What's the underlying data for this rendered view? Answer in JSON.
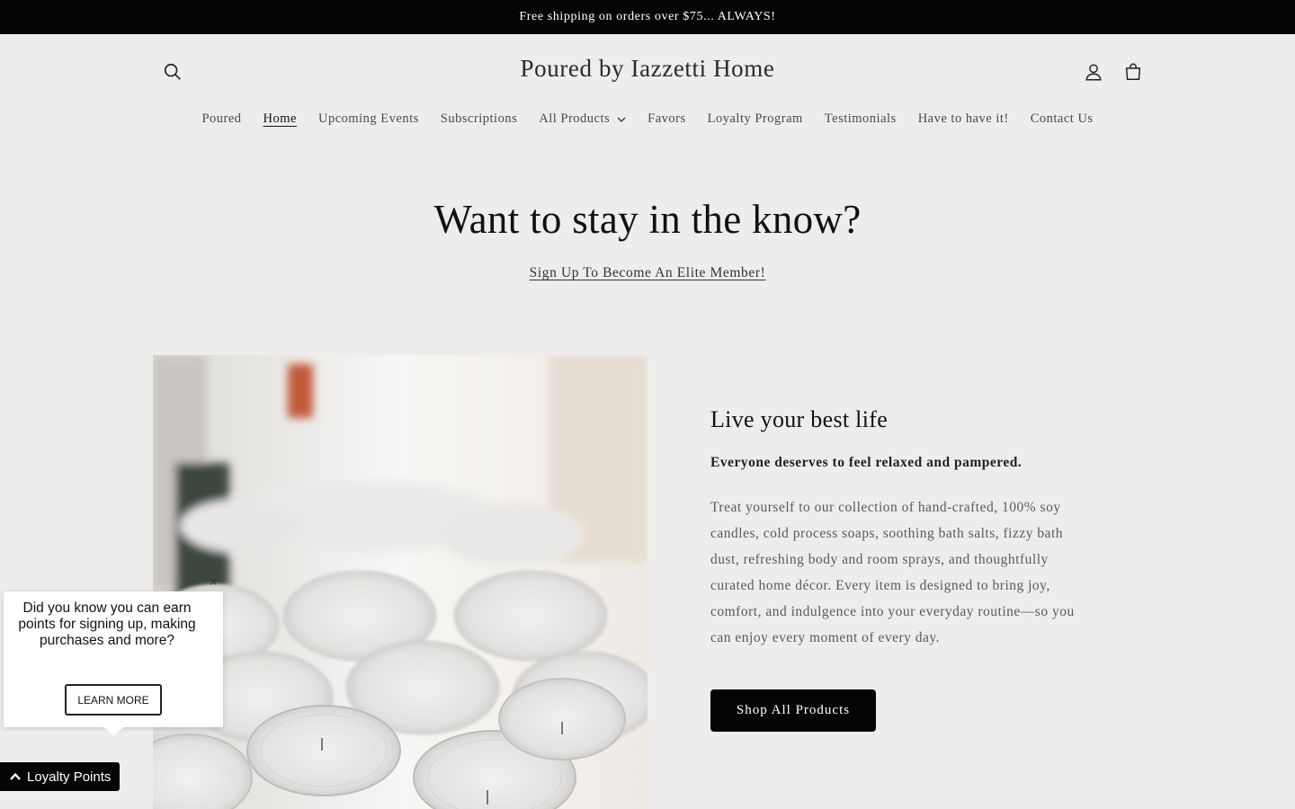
{
  "announcement": {
    "text": "Free shipping on orders over $75... ALWAYS!"
  },
  "header": {
    "site_title": "Poured by Iazzetti Home",
    "icons": {
      "search": "search-icon",
      "account": "account-icon",
      "cart": "cart-icon"
    }
  },
  "nav": {
    "items": [
      {
        "label": "Poured"
      },
      {
        "label": "Home",
        "active": true
      },
      {
        "label": "Upcoming Events"
      },
      {
        "label": "Subscriptions"
      },
      {
        "label": "All Products",
        "has_dropdown": true
      },
      {
        "label": "Favors"
      },
      {
        "label": "Loyalty Program"
      },
      {
        "label": "Testimonials"
      },
      {
        "label": "Have to have it!"
      },
      {
        "label": "Contact Us"
      }
    ]
  },
  "hero": {
    "title": "Want to stay in the know?",
    "link": "Sign Up To Become An Elite Member!"
  },
  "feature": {
    "heading": "Live your best life",
    "subheading": "Everyone deserves to feel relaxed and pampered.",
    "body": "Treat yourself to our collection of hand-crafted, 100% soy candles, cold process soaps, soothing bath salts, fizzy bath dust, refreshing body and room sprays, and thoughtfully curated home décor. Every item is designed to bring joy, comfort, and indulgence into your everyday routine—so you can enjoy every moment of every day.",
    "button": "Shop All Products"
  },
  "loyalty_popup": {
    "text": "Did you know you can earn points for signing up, making purchases and more?",
    "button": "LEARN MORE",
    "close": "×"
  },
  "loyalty_tab": {
    "label": "Loyalty Points",
    "icon": "chevron-up-icon"
  },
  "colors": {
    "background": "#eeedeb",
    "announcement_bg": "#050505",
    "button_bg": "#050505"
  }
}
